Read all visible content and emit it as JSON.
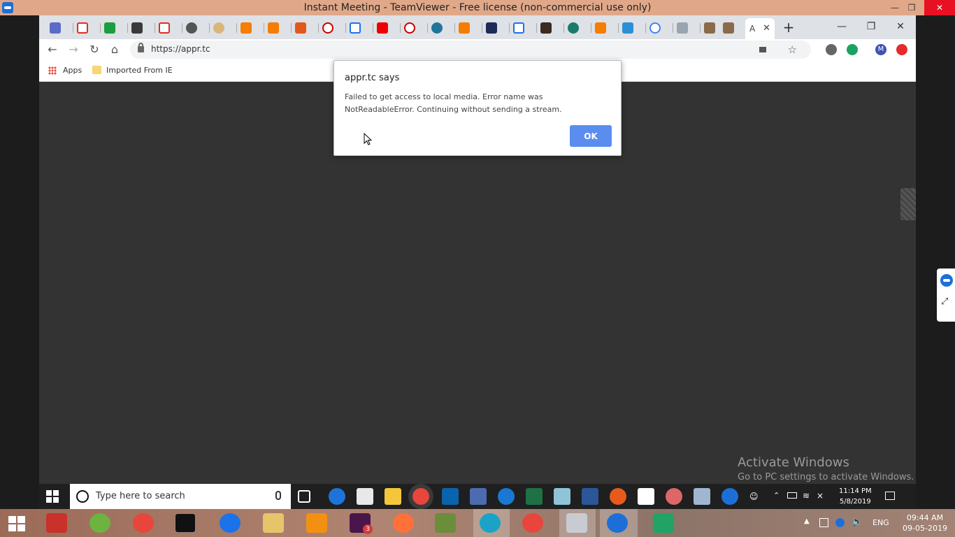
{
  "window": {
    "title": "Instant Meeting - TeamViewer - Free license (non-commercial use only)"
  },
  "chrome": {
    "active_tab_label": "A",
    "new_tab_symbol": "+",
    "url": "https://appr.tc",
    "bookmarks": [
      {
        "label": "Apps"
      },
      {
        "label": "Imported From IE"
      }
    ],
    "profile_initial": "M"
  },
  "dialog": {
    "title": "appr.tc says",
    "message": "Failed to get access to local media. Error name was NotReadableError. Continuing without sending a stream.",
    "ok_label": "OK"
  },
  "watermark": {
    "line1": "Activate Windows",
    "line2": "Go to PC settings to activate Windows."
  },
  "remote_taskbar": {
    "search_placeholder": "Type here to search",
    "time": "11:14 PM",
    "date": "5/8/2019"
  },
  "local_taskbar": {
    "language": "ENG",
    "time": "09:44 AM",
    "date": "09-05-2019",
    "slack_badge": "3"
  }
}
